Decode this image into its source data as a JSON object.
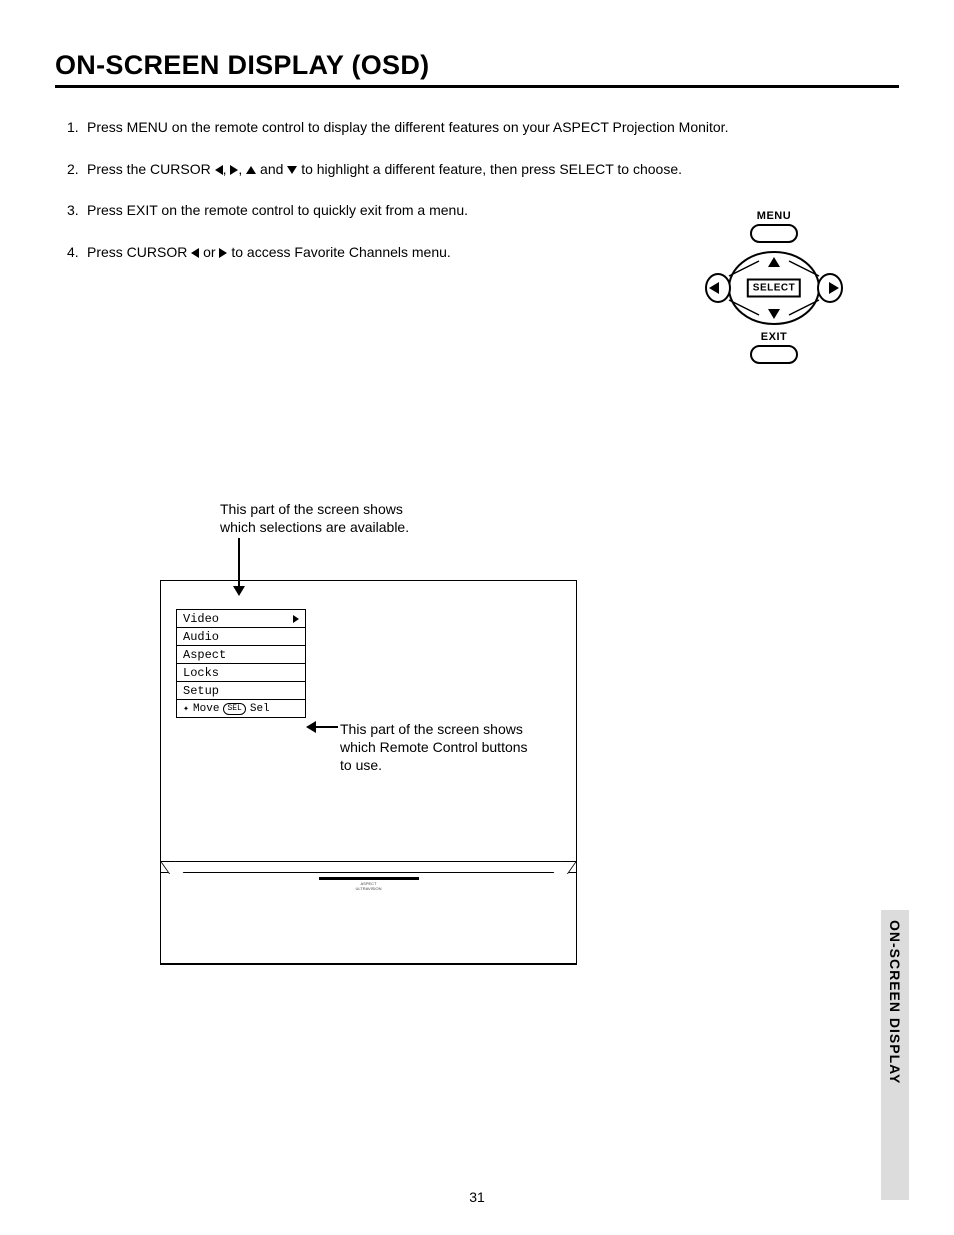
{
  "title": "ON-SCREEN DISPLAY (OSD)",
  "steps": {
    "s1_pre": "Press MENU on the remote control to display the different features on your ASPECT Projection Monitor.",
    "s2_a": "Press the CURSOR ",
    "s2_b": ", ",
    "s2_c": ", ",
    "s2_d": " and ",
    "s2_e": " to highlight a different feature, then press SELECT to choose.",
    "s3": "Press EXIT on the remote control to quickly exit from a menu.",
    "s4_a": "Press CURSOR ",
    "s4_b": " or ",
    "s4_c": " to access Favorite Channels menu."
  },
  "remote": {
    "menu": "MENU",
    "select": "SELECT",
    "exit": "EXIT"
  },
  "caption1_l1": "This part of the screen shows",
  "caption1_l2": "which selections are available.",
  "caption2_l1": "This part of the screen shows",
  "caption2_l2": "which Remote Control buttons",
  "caption2_l3": "to use.",
  "osd_menu": {
    "items": [
      "Video",
      "Audio",
      "Aspect",
      "Locks",
      "Setup"
    ],
    "hint_move": "Move",
    "hint_sel_box": "SEL",
    "hint_sel": "Sel"
  },
  "brand_line1": "ASPECT",
  "brand_line2": "ULTRAVISION",
  "side_tab": "ON-SCREEN DISPLAY",
  "page_number": "31"
}
